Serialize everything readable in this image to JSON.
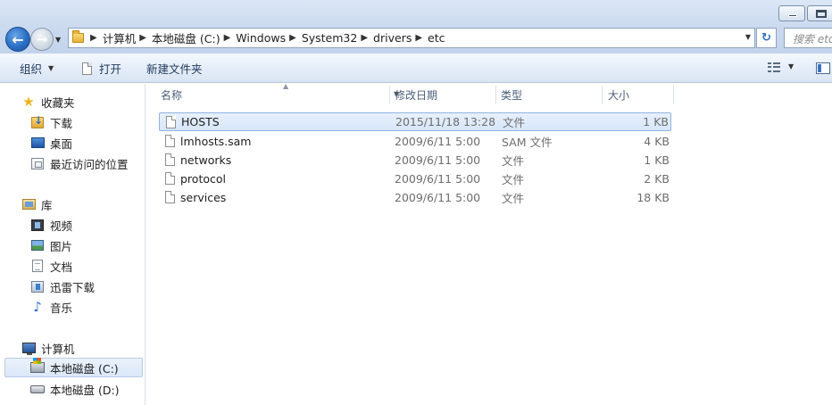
{
  "address": {
    "crumbs": [
      "计算机",
      "本地磁盘 (C:)",
      "Windows",
      "System32",
      "drivers",
      "etc"
    ]
  },
  "search": {
    "placeholder": "搜索 etc"
  },
  "toolbar": {
    "organize_label": "组织",
    "open_label": "打开",
    "new_folder_label": "新建文件夹"
  },
  "sidebar": {
    "favorites": {
      "label": "收藏夹",
      "items": [
        "下载",
        "桌面",
        "最近访问的位置"
      ]
    },
    "libraries": {
      "label": "库",
      "items": [
        "视频",
        "图片",
        "文档",
        "迅雷下载",
        "音乐"
      ]
    },
    "computer": {
      "label": "计算机",
      "items": [
        "本地磁盘 (C:)",
        "本地磁盘 (D:)"
      ]
    }
  },
  "columns": {
    "name": "名称",
    "date": "修改日期",
    "type": "类型",
    "size": "大小"
  },
  "files": [
    {
      "name": "HOSTS",
      "date": "2015/11/18 13:28",
      "type": "文件",
      "size": "1 KB"
    },
    {
      "name": "lmhosts.sam",
      "date": "2009/6/11 5:00",
      "type": "SAM 文件",
      "size": "4 KB"
    },
    {
      "name": "networks",
      "date": "2009/6/11 5:00",
      "type": "文件",
      "size": "1 KB"
    },
    {
      "name": "protocol",
      "date": "2009/6/11 5:00",
      "type": "文件",
      "size": "2 KB"
    },
    {
      "name": "services",
      "date": "2009/6/11 5:00",
      "type": "文件",
      "size": "18 KB"
    }
  ]
}
